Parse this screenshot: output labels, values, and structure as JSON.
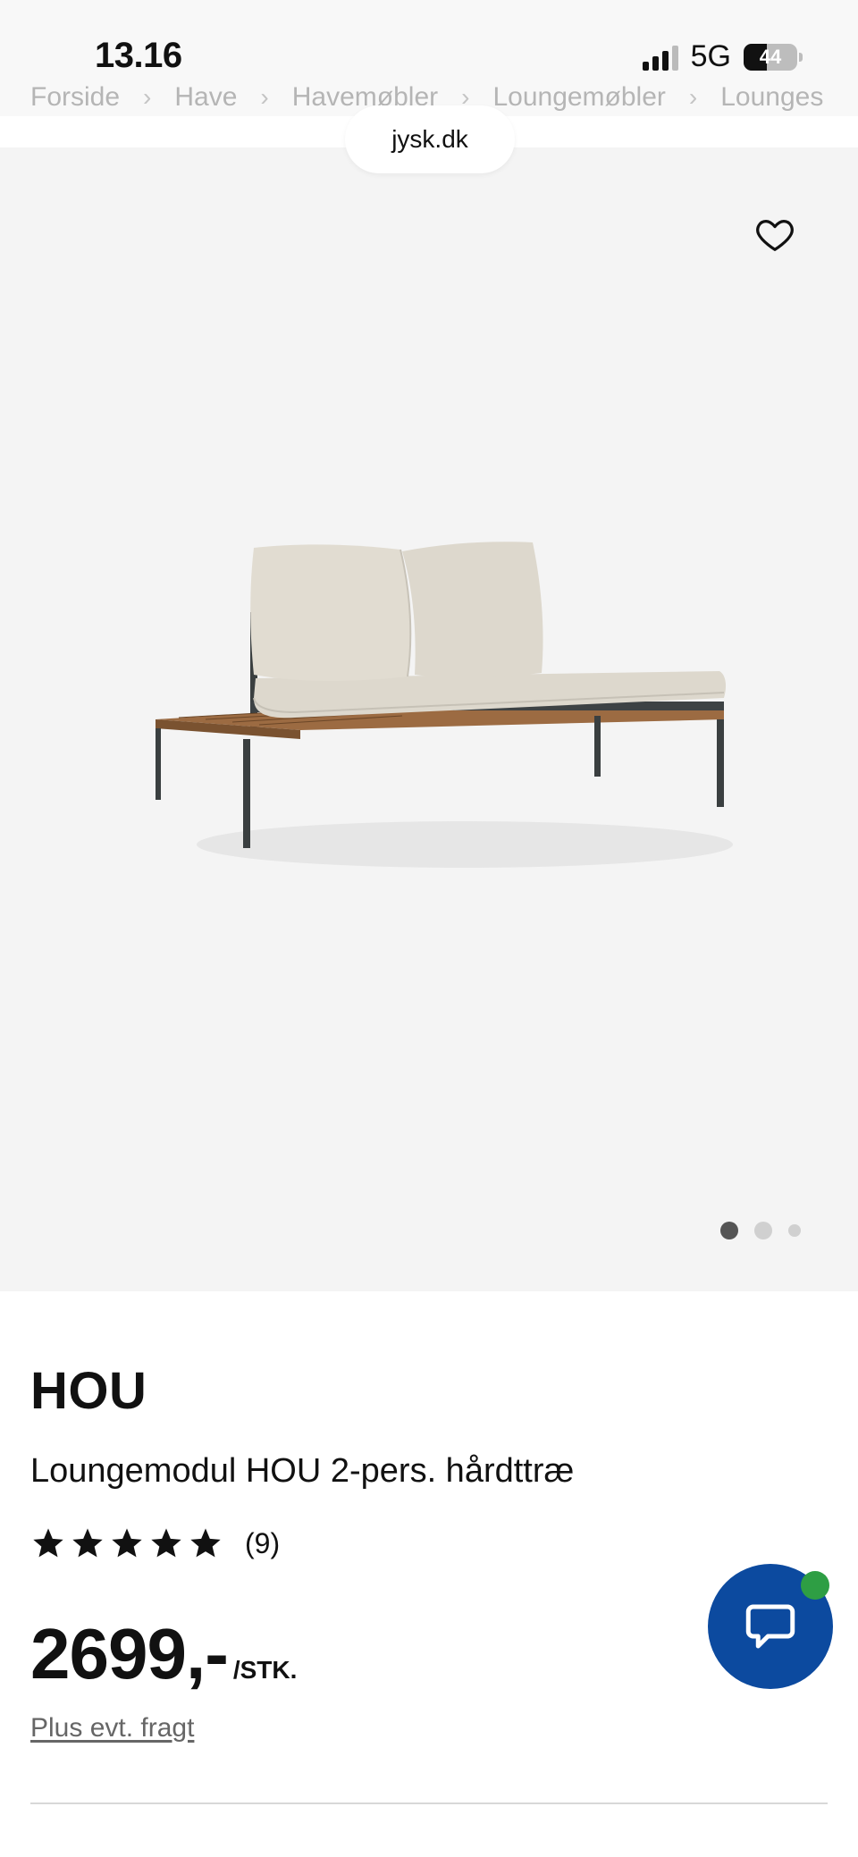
{
  "status_bar": {
    "time": "13.16",
    "network": "5G",
    "battery": "44",
    "battery_level": 0.44
  },
  "breadcrumb": {
    "items": [
      "Forside",
      "Have",
      "Havemøbler",
      "Loungemøbler",
      "Lounges"
    ]
  },
  "browser": {
    "url": "jysk.dk"
  },
  "gallery": {
    "image_count": 3,
    "active_index": 0,
    "favorite_icon": "heart-outline-icon"
  },
  "product": {
    "brand": "HOU",
    "name": "Loungemodul HOU 2-pers. hårdttræ",
    "rating": 5,
    "rating_max": 5,
    "review_count": "(9)",
    "price": "2699,-",
    "unit": "/STK.",
    "freight_note": "Plus evt. fragt"
  },
  "chat": {
    "icon": "chat-bubble-icon",
    "online_color": "#2e9e44",
    "button_color": "#0c4a9f"
  }
}
